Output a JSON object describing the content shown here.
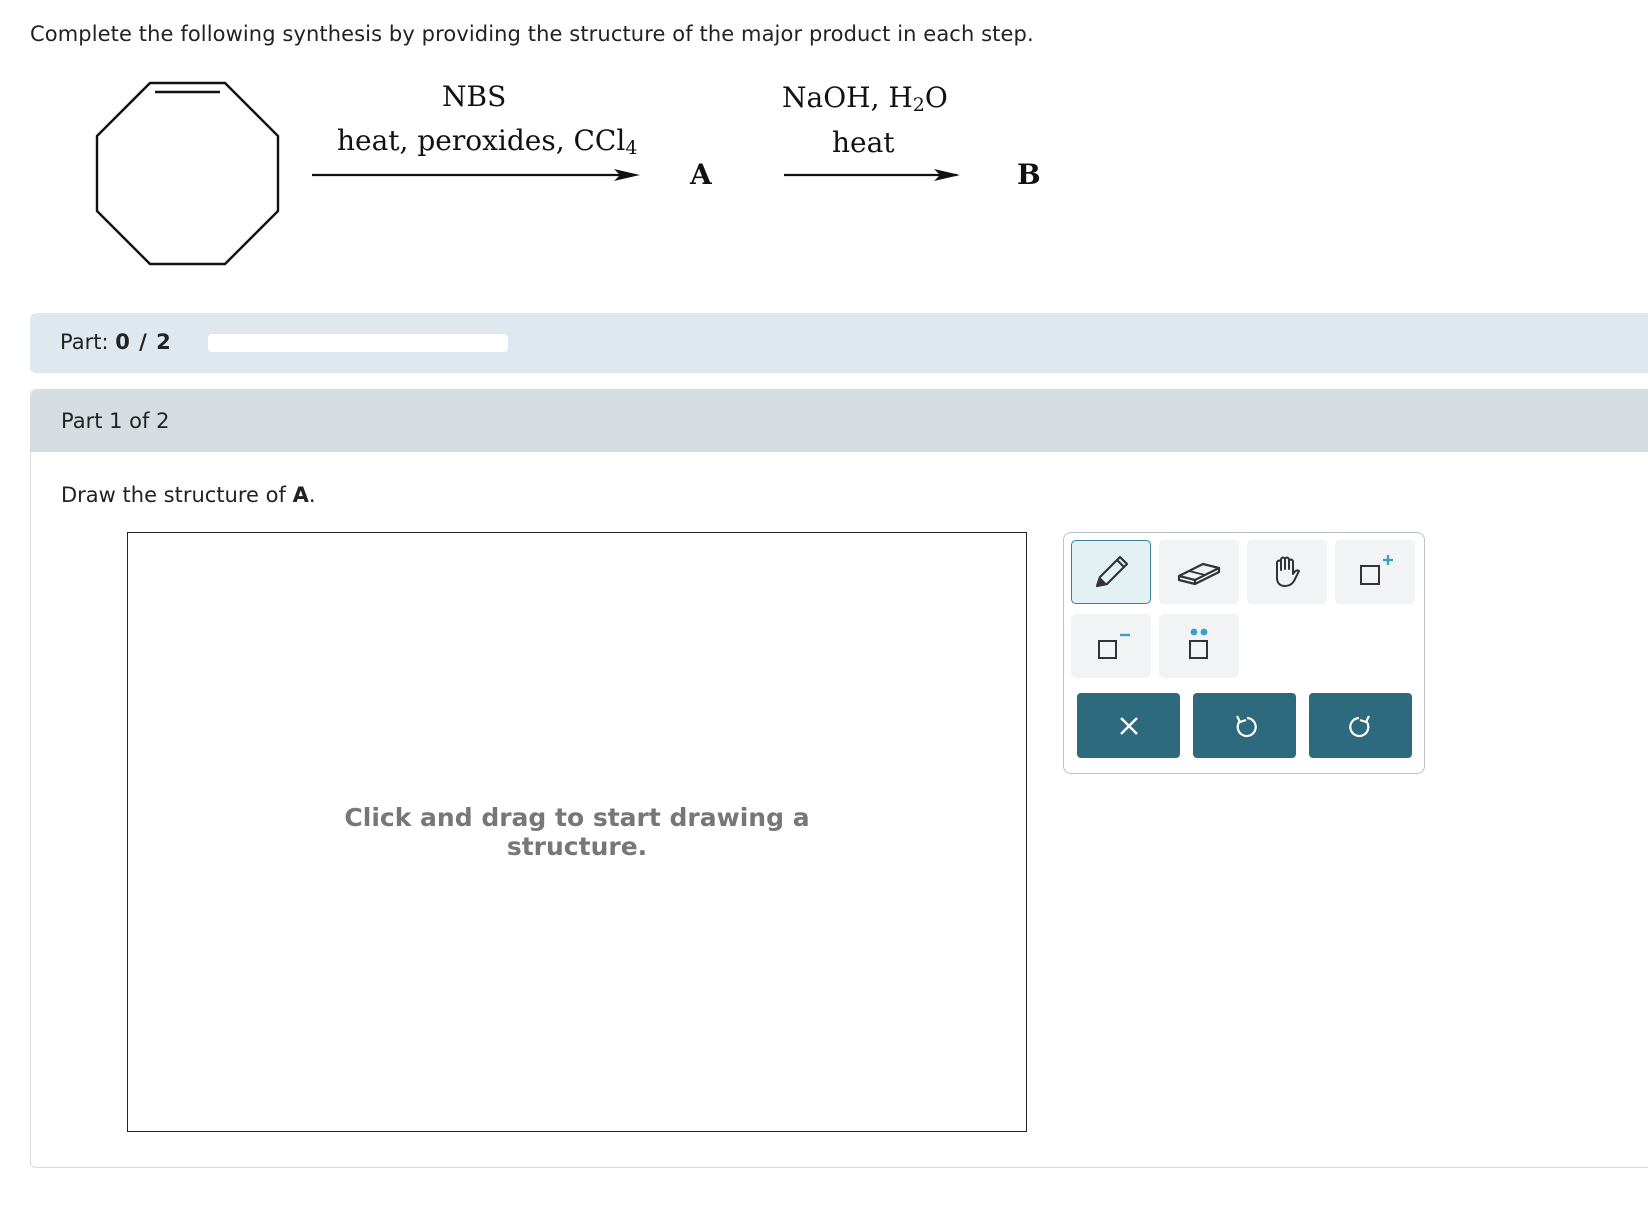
{
  "question": "Complete the following synthesis by providing the structure of the major product in each step.",
  "scheme": {
    "step1": {
      "reagent_line1": "NBS",
      "reagent_line2": "heat, peroxides, CCl",
      "reagent_line2_sub": "4"
    },
    "product1_label": "A",
    "step2": {
      "reagent_line1_a": "NaOH, H",
      "reagent_line1_sub": "2",
      "reagent_line1_b": "O",
      "reagent_line2": "heat"
    },
    "product2_label": "B"
  },
  "part_progress": {
    "label": "Part:",
    "value": "0 / 2",
    "completed_fraction": 0
  },
  "part": {
    "header": "Part 1 of 2",
    "instruction_prefix": "Draw the structure of ",
    "instruction_target": "A",
    "instruction_suffix": ".",
    "canvas_hint": "Click and drag to start drawing a structure."
  },
  "toolbar": {
    "tools": [
      "pencil-icon",
      "eraser-icon",
      "hand-icon",
      "positive-charge-icon",
      "negative-charge-icon",
      "lone-pair-icon"
    ],
    "actions": [
      "clear-icon",
      "undo-icon",
      "redo-icon"
    ],
    "accent_color": "#2d6a7e",
    "icon_highlight_color": "#3aa1c4"
  }
}
